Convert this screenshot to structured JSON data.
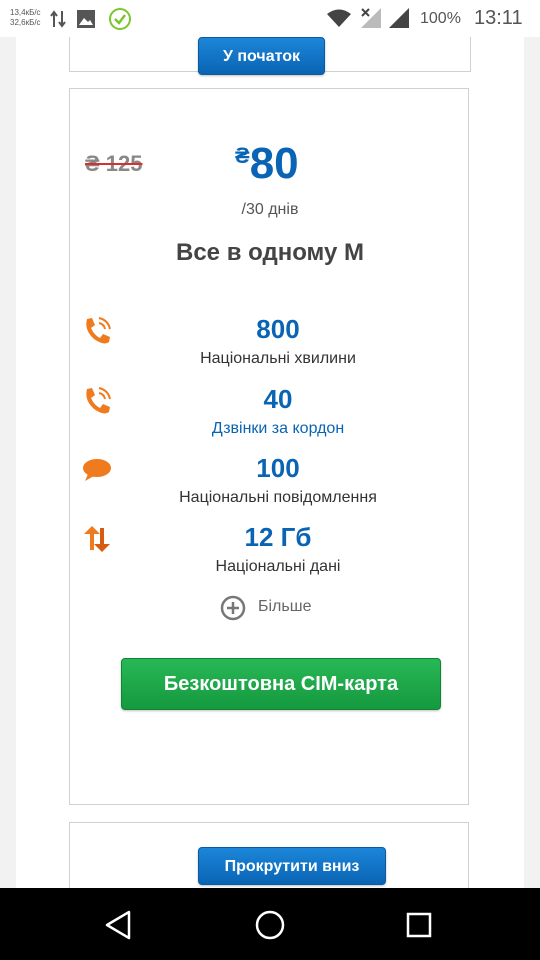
{
  "status_bar": {
    "net_speed_up": "13,4кБ/с",
    "net_speed_down": "32,6кБ/с",
    "battery": "100%",
    "time": "13:11",
    "icons": [
      "transfer-arrows-icon",
      "image-icon",
      "check-circle-icon",
      "wifi-icon",
      "no-signal-icon",
      "signal-icon"
    ]
  },
  "top_button": {
    "label": "У початок"
  },
  "plan": {
    "old_price": "₴ 125",
    "currency": "₴",
    "price": "80",
    "period": "/30 днів",
    "title": "Все в одному М",
    "features": [
      {
        "icon": "phone-icon",
        "value": "800",
        "label": "Національні хвилини"
      },
      {
        "icon": "phone-icon",
        "value": "40",
        "label": "Дзвінки за кордон"
      },
      {
        "icon": "chat-bubble-icon",
        "value": "100",
        "label": "Національні повідомлення"
      },
      {
        "icon": "data-arrows-icon",
        "value": "12 Гб",
        "label": "Національні дані"
      }
    ],
    "more_label": "Більше",
    "cta_label": "Безкоштовна СІМ-карта"
  },
  "bottom_button": {
    "label": "Прокрутити вниз"
  },
  "colors": {
    "accent": "#0a64b4",
    "orange": "#f07b1e",
    "green": "#1fa84a",
    "strike": "#d9302c"
  },
  "nav_bar": {
    "icons": [
      "back-icon",
      "home-icon",
      "recents-icon"
    ]
  }
}
